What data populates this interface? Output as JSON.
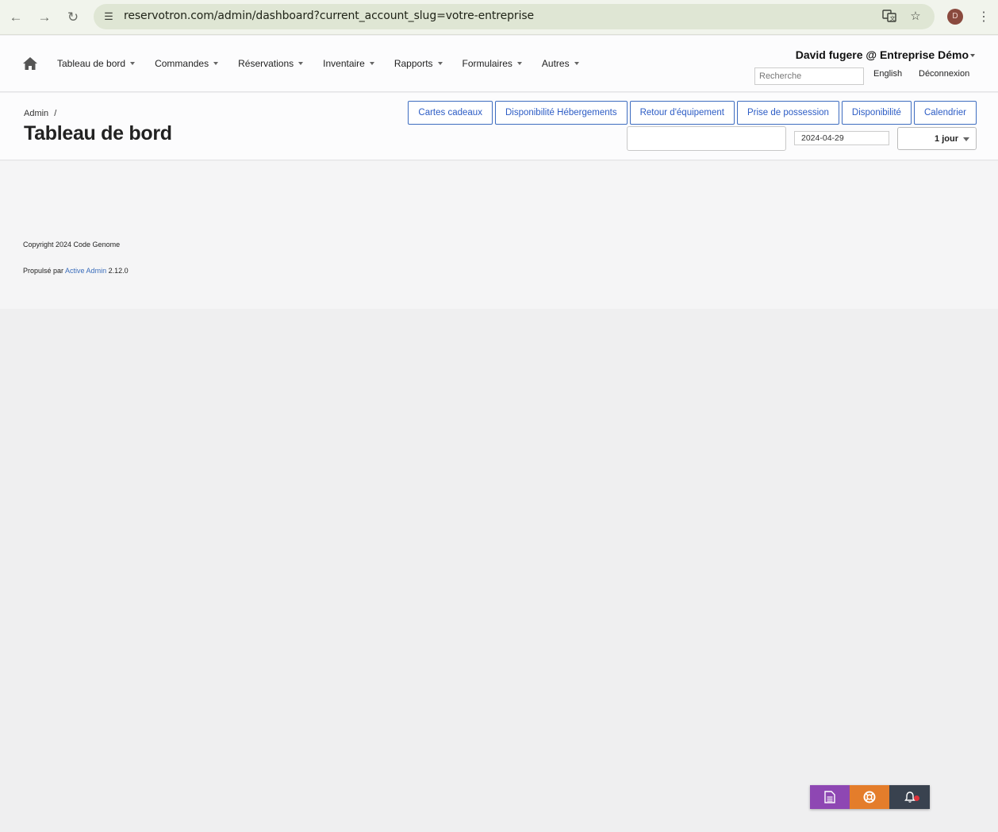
{
  "browser": {
    "url": "reservotron.com/admin/dashboard?current_account_slug=votre-entreprise",
    "profile_initial": "D"
  },
  "header": {
    "menu": [
      {
        "label": "Tableau de bord"
      },
      {
        "label": "Commandes"
      },
      {
        "label": "Réservations"
      },
      {
        "label": "Inventaire"
      },
      {
        "label": "Rapports"
      },
      {
        "label": "Formulaires"
      },
      {
        "label": "Autres"
      }
    ],
    "user": "David fugere @ Entreprise Démo",
    "search_placeholder": "Recherche",
    "language_link": "English",
    "logout_link": "Déconnexion"
  },
  "titlebar": {
    "breadcrumb": "Admin",
    "breadcrumb_sep": "/",
    "title": "Tableau de bord",
    "actions": [
      "Cartes cadeaux",
      "Disponibilité Hébergements",
      "Retour d'équipement",
      "Prise de possession",
      "Disponibilité",
      "Calendrier"
    ],
    "date_value": "2024-04-29",
    "period_value": "1 jour"
  },
  "footer": {
    "copyright": "Copyright 2024 Code Genome",
    "powered_prefix": "Propulsé par",
    "powered_link": "Active Admin",
    "powered_version": "2.12.0"
  },
  "widget": {
    "colors": {
      "purple": "#8e47b3",
      "orange": "#e47d2b",
      "dark": "#39424f",
      "alert": "#e0333c"
    },
    "icons": [
      "document-icon",
      "lifebuoy-icon",
      "bell-icon"
    ]
  },
  "colors": {
    "link_blue": "#2c5cc5"
  }
}
